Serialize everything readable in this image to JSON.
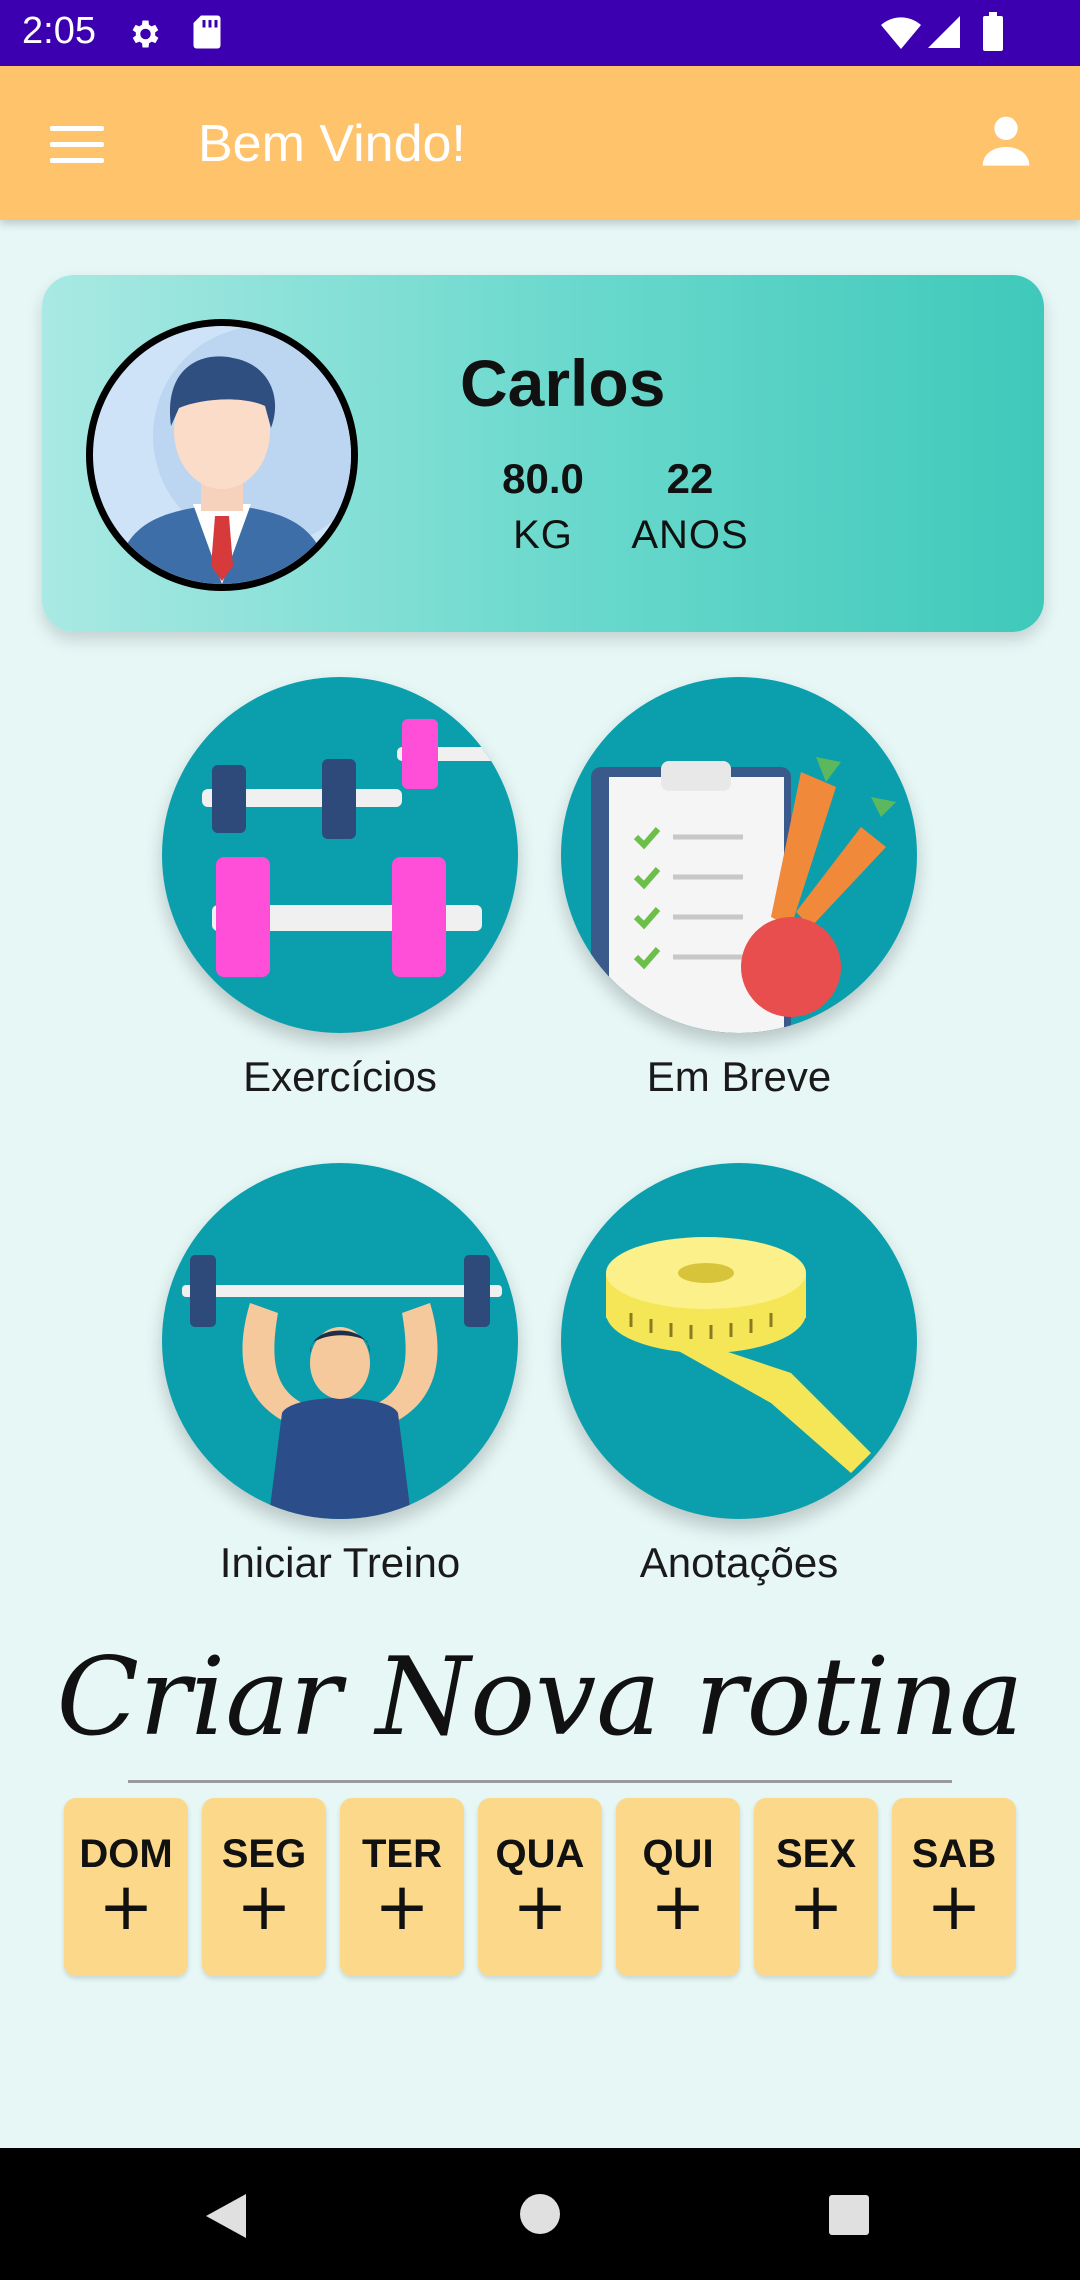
{
  "status_bar": {
    "time": "2:05",
    "icons": [
      "gear-icon",
      "sd-card-icon",
      "wifi-icon",
      "signal-icon",
      "battery-icon"
    ],
    "background": "#3d00b0"
  },
  "app_bar": {
    "title": "Bem Vindo!",
    "background": "#ffc36b",
    "icons": [
      "menu-icon",
      "profile-icon"
    ]
  },
  "profile": {
    "name": "Carlos",
    "weight_value": "80.0",
    "weight_unit": "KG",
    "age_value": "22",
    "age_unit": "ANOS"
  },
  "tiles": [
    {
      "label": "Exercícios",
      "icon": "dumbbells-icon"
    },
    {
      "label": "Em Breve",
      "icon": "diet-clipboard-icon"
    },
    {
      "label": "Iniciar Treino",
      "icon": "weightlifter-icon"
    },
    {
      "label": "Anotações",
      "icon": "measuring-tape-icon"
    }
  ],
  "routine": {
    "title": "Criar Nova rotina",
    "days": [
      {
        "label": "DOM",
        "action": "+"
      },
      {
        "label": "SEG",
        "action": "+"
      },
      {
        "label": "TER",
        "action": "+"
      },
      {
        "label": "QUA",
        "action": "+"
      },
      {
        "label": "QUI",
        "action": "+"
      },
      {
        "label": "SEX",
        "action": "+"
      },
      {
        "label": "SAB",
        "action": "+"
      }
    ]
  },
  "nav_bar": {
    "icons": [
      "back-icon",
      "home-icon",
      "recents-icon"
    ]
  }
}
